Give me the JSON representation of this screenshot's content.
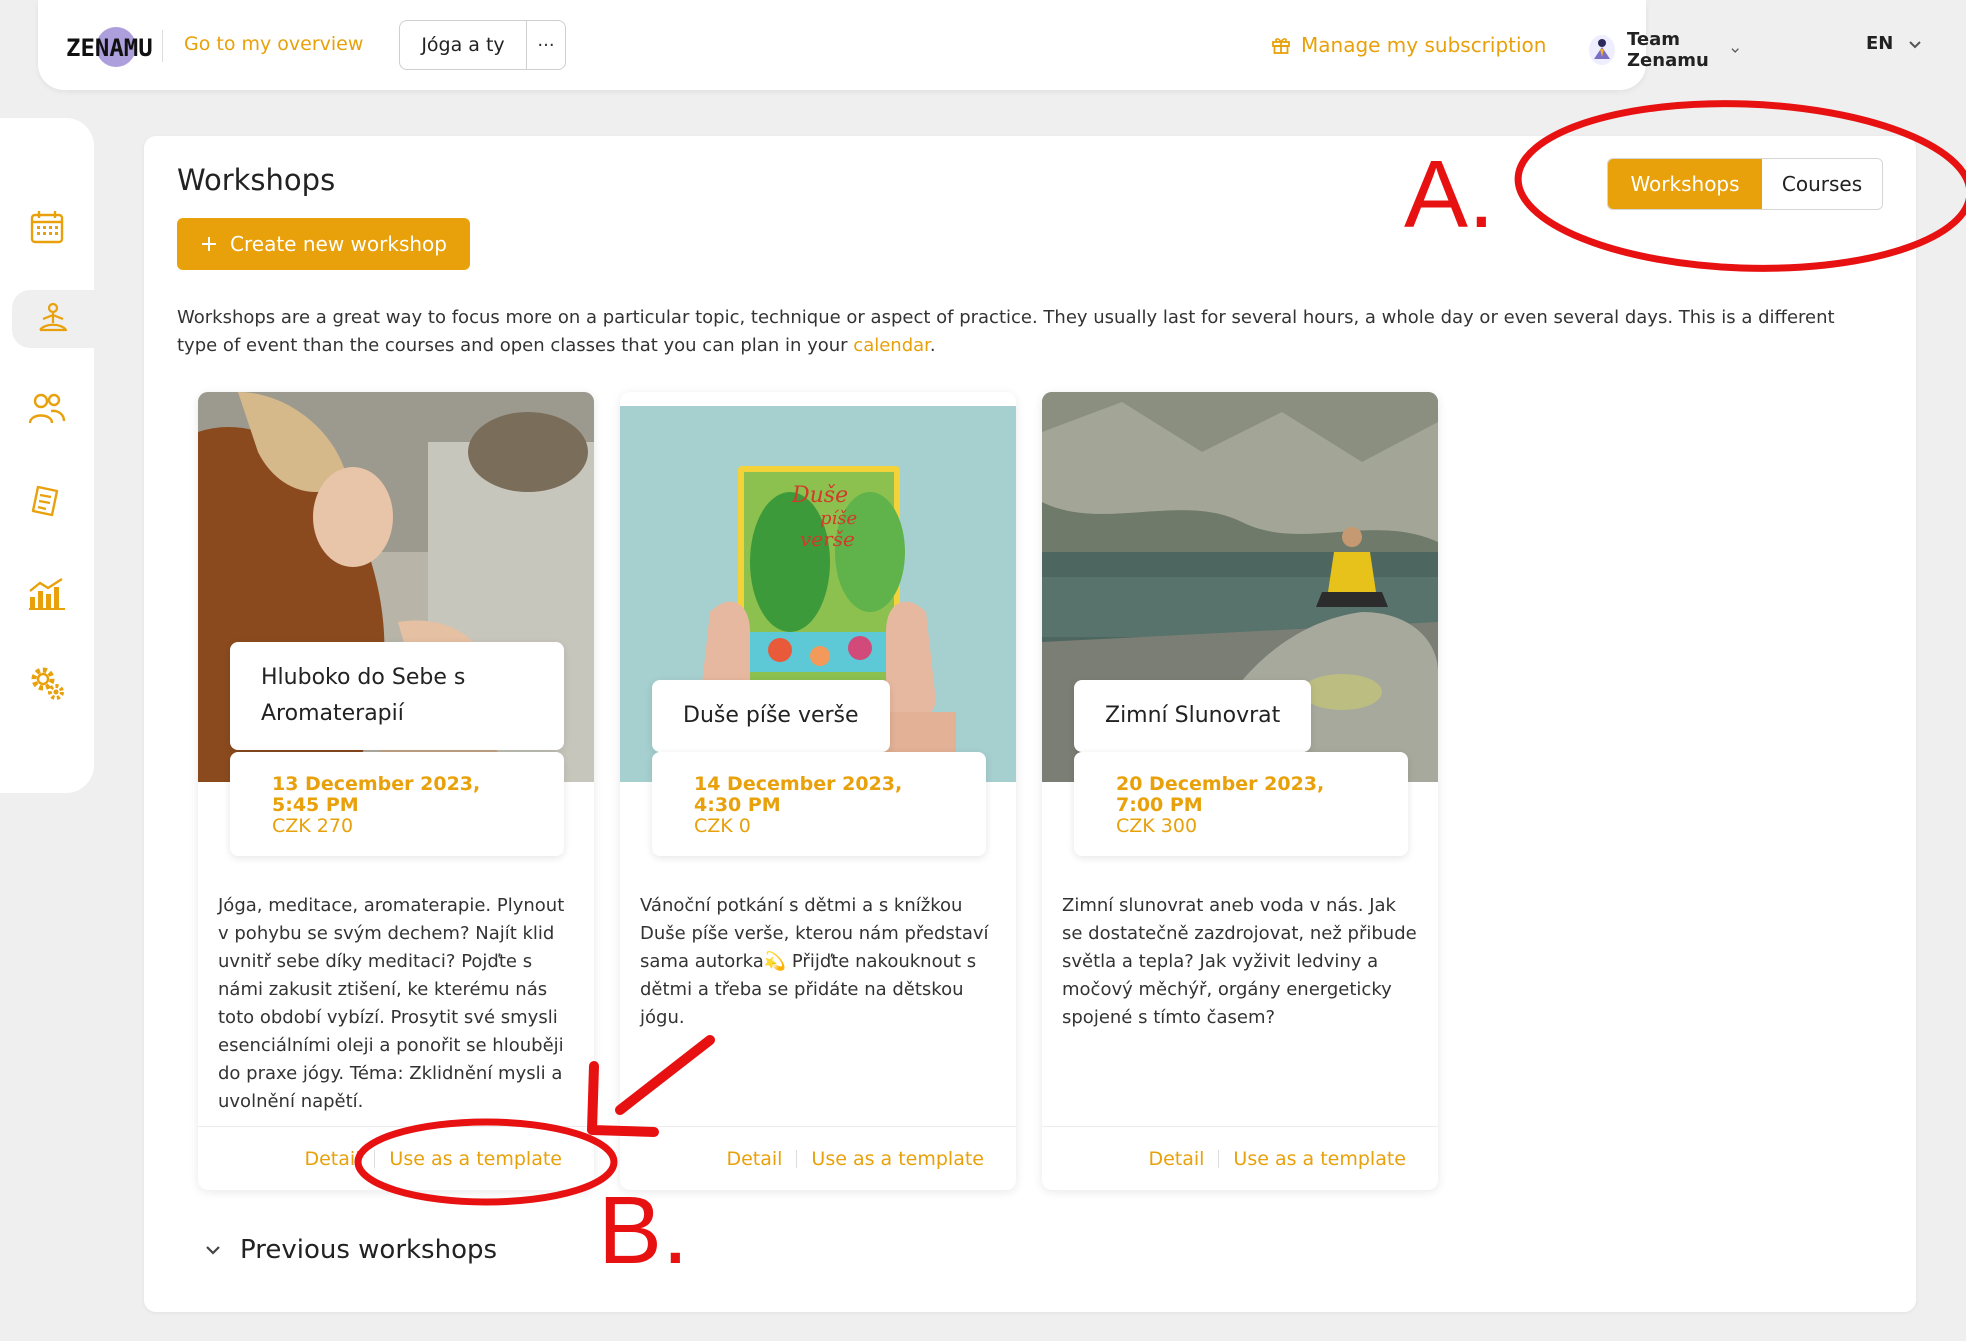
{
  "header": {
    "logo_text": "ZENAMU",
    "overview_link": "Go to my overview",
    "studio_name": "Jóga a ty",
    "more_label": "···",
    "subscription_link": "Manage my subscription",
    "team_name": "Team Zenamu",
    "language": "EN"
  },
  "sidebar": {
    "items": [
      {
        "icon": "calendar-icon"
      },
      {
        "icon": "meditation-icon",
        "active": true
      },
      {
        "icon": "people-icon"
      },
      {
        "icon": "notes-icon"
      },
      {
        "icon": "stats-icon"
      },
      {
        "icon": "settings-icon"
      }
    ]
  },
  "main": {
    "title": "Workshops",
    "create_button": "Create new workshop",
    "toggle": {
      "active": "Workshops",
      "inactive": "Courses"
    },
    "description": "Workshops are a great way to focus more on a particular topic, technique or aspect of practice. They usually last for several hours, a whole day or even several days. This is a different type of event than the courses and open classes that you can plan in your",
    "description_link": "calendar",
    "description_end": ".",
    "cards": [
      {
        "title": "Hluboko do Sebe s Aromaterapií",
        "date": "13 December 2023, 5:45 PM",
        "price": "CZK 270",
        "text": "Jóga, meditace, aromaterapie. Plynout v pohybu se svým dechem? Najít klid uvnitř sebe díky meditaci? Pojďte s námi zakusit ztišení, ke kterému nás toto období vybízí. Prosytit své smysli esenciálními oleji a ponořit se hlouběji do praxe jógy. Téma: Zklidnění mysli a uvolnění napětí.",
        "detail": "Detail",
        "template": "Use as a template"
      },
      {
        "title": "Duše píše verše",
        "date": "14 December 2023, 4:30 PM",
        "price": "CZK 0",
        "text": "Vánoční potkání s dětmi a s knížkou Duše píše verše, kterou nám představí sama autorka💫 Přijďte nakouknout s dětmi a třeba se přidáte na dětskou jógu.",
        "detail": "Detail",
        "template": "Use as a template",
        "book_title_1": "Duše",
        "book_title_2": "píše",
        "book_title_3": "verše"
      },
      {
        "title": "Zimní Slunovrat",
        "date": "20 December 2023, 7:00 PM",
        "price": "CZK 300",
        "text": "Zimní slunovrat aneb voda v nás. Jak se dostatečně zazdrojovat, než přibude světla a tepla? Jak vyživit ledviny a močový měchýř, orgány energeticky spojené s tímto časem?",
        "detail": "Detail",
        "template": "Use as a template"
      }
    ],
    "previous": "Previous workshops"
  },
  "annotations": {
    "label_a": "A.",
    "label_b": "B.",
    "color": "#e81111"
  },
  "colors": {
    "accent": "#e8a10a",
    "background": "#efefef"
  }
}
